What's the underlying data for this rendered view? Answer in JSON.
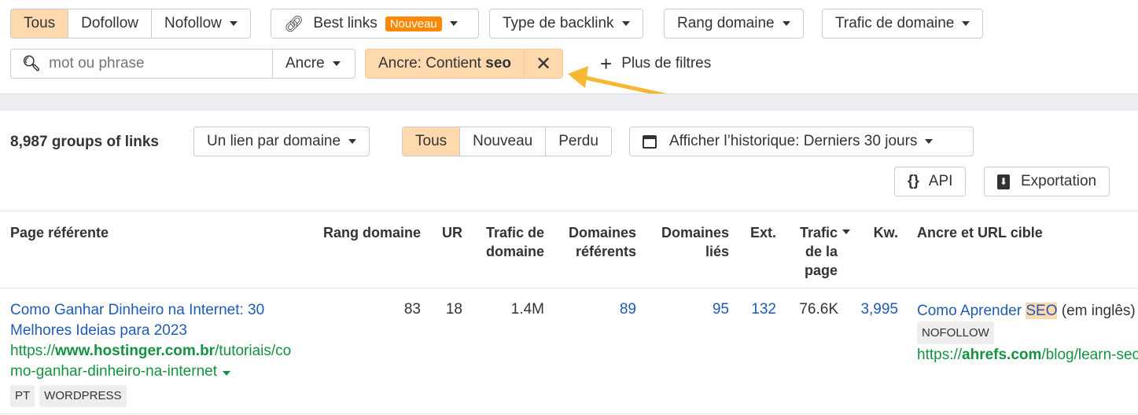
{
  "filters": {
    "link_types": [
      "Tous",
      "Dofollow",
      "Nofollow"
    ],
    "best_links": "Best links",
    "new_badge": "Nouveau",
    "backlink_type": "Type de backlink",
    "domain_rating": "Rang domaine",
    "domain_traffic": "Trafic de domaine",
    "search_placeholder": "mot ou phrase",
    "anchor_select": "Ancre",
    "active_filter_prefix": "Ancre: Contient ",
    "active_filter_value": "seo",
    "more_filters": "Plus de filtres"
  },
  "toolbar": {
    "count": "8,987 groups of links",
    "grouping": "Un lien par domaine",
    "status_tabs": [
      "Tous",
      "Nouveau",
      "Perdu"
    ],
    "history": "Afficher l’historique: Derniers 30 jours",
    "api": "API",
    "export": "Exportation"
  },
  "table": {
    "headers": [
      "Page référente",
      "Rang domaine",
      "UR",
      "Trafic de domaine",
      "Domaines référents",
      "Domaines liés",
      "Ext.",
      "Trafic de la page",
      "Kw.",
      "Ancre et URL cible"
    ],
    "rows": [
      {
        "title": "Como Ganhar Dinheiro na Internet: 30 Melhores Ideias para 2023",
        "url_prefix": "https://",
        "url_domain": "www.hostinger.com.br",
        "url_path": "/tutoriais/como-ganhar-dinheiro-na-internet",
        "tags": [
          "PT",
          "WORDPRESS"
        ],
        "dr": "83",
        "ur": "18",
        "domain_traffic": "1.4M",
        "ref_domains": "89",
        "linked_domains": "95",
        "ext": "132",
        "page_traffic": "76.6K",
        "kw": "3,995",
        "anchor_before": "Como Aprender ",
        "anchor_highlight": "SEO",
        "anchor_after": " (em inglês)",
        "link_tag": "NOFOLLOW",
        "target_prefix": "https://",
        "target_domain": "ahrefs.com",
        "target_path": "/blog/learn-seo/"
      }
    ]
  },
  "colors": {
    "accent": "#fdd9ad",
    "badge": "#ff8800",
    "link": "#1f5bb5",
    "url": "#14923f",
    "arrow": "#f7b733"
  }
}
